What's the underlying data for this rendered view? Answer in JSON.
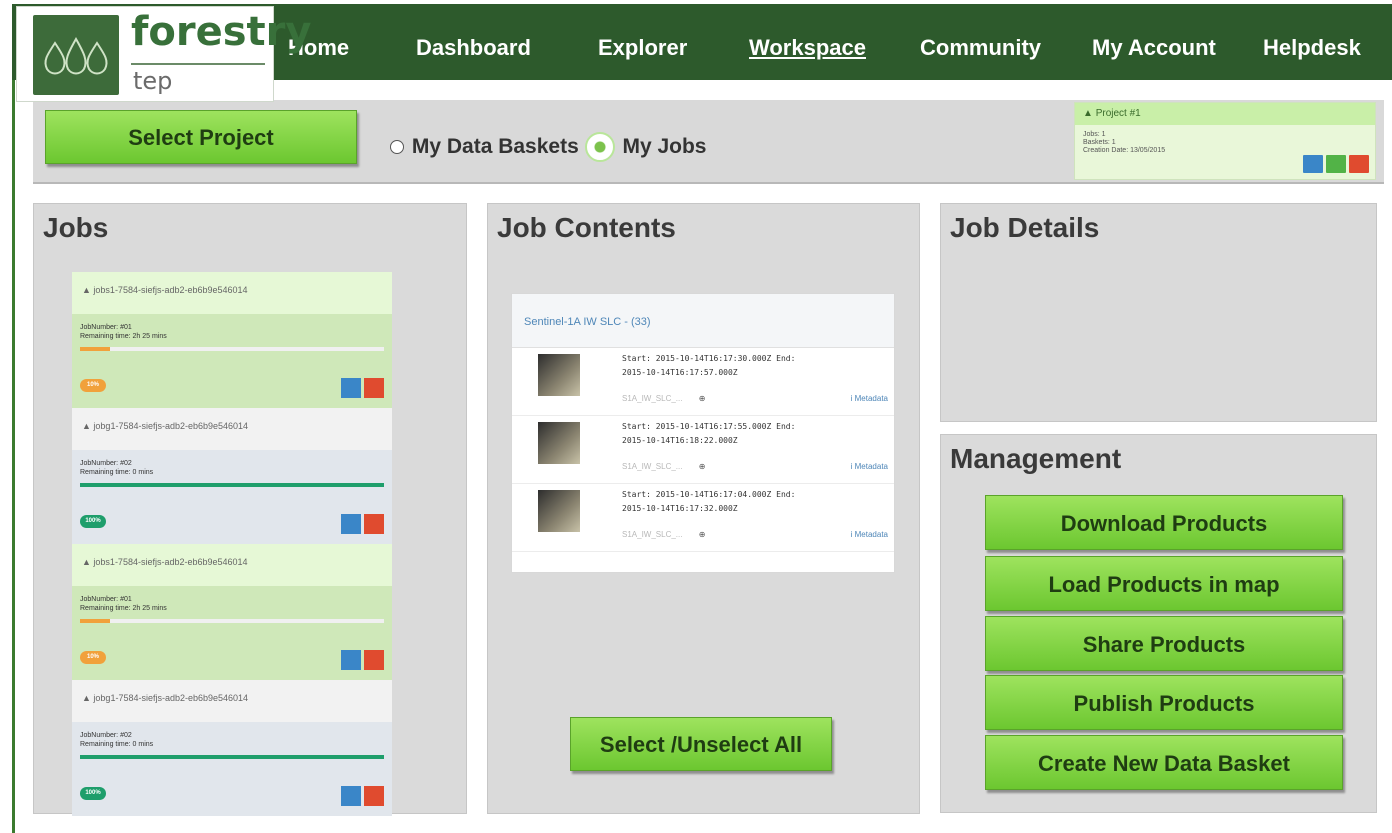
{
  "brand": {
    "name": "forestry",
    "sub": "tep",
    "logo_icon": "forest-drops-logo"
  },
  "nav": {
    "items": [
      {
        "label": "Home",
        "active": false
      },
      {
        "label": "Dashboard",
        "active": false
      },
      {
        "label": "Explorer",
        "active": false
      },
      {
        "label": "Workspace",
        "active": true
      },
      {
        "label": "Community",
        "active": false
      },
      {
        "label": "My Account",
        "active": false
      },
      {
        "label": "Helpdesk",
        "active": false
      }
    ]
  },
  "project_bar": {
    "select_label": "Select Project",
    "radio_baskets": "My Data Baskets",
    "radio_jobs": "My Jobs",
    "selected": "My Jobs",
    "card": {
      "title": "Project #1",
      "line1": "Jobs: 1",
      "line2": "Baskets: 1",
      "line3": "Creation Date: 13/05/2015"
    }
  },
  "jobs": {
    "title": "Jobs",
    "items": [
      {
        "id": "jobs1-7584-siefjs-adb2-eb6b9e546014",
        "number": "JobNumber: #01",
        "remaining": "Remaining time: 2h 25 mins",
        "progress": 0.1,
        "badge": "10%",
        "state": "ok"
      },
      {
        "id": "jobg1-7584-siefjs-adb2-eb6b9e546014",
        "number": "JobNumber: #02",
        "remaining": "Remaining time: 0 mins",
        "progress": 1.0,
        "badge": "100%",
        "state": "run"
      },
      {
        "id": "jobs1-7584-siefjs-adb2-eb6b9e546014",
        "number": "JobNumber: #01",
        "remaining": "Remaining time: 2h 25 mins",
        "progress": 0.1,
        "badge": "10%",
        "state": "ok"
      },
      {
        "id": "jobg1-7584-siefjs-adb2-eb6b9e546014",
        "number": "JobNumber: #02",
        "remaining": "Remaining time: 0 mins",
        "progress": 1.0,
        "badge": "100%",
        "state": "run"
      }
    ]
  },
  "contents": {
    "title": "Job Contents",
    "group": "Sentinel-1A IW SLC - (33)",
    "products": [
      {
        "line1": "Start: 2015-10-14T16:17:30.000Z End:",
        "line2": "2015-10-14T16:17:57.000Z",
        "name": "S1A_IW_SLC_...",
        "metadata": "Metadata"
      },
      {
        "line1": "Start: 2015-10-14T16:17:55.000Z End:",
        "line2": "2015-10-14T16:18:22.000Z",
        "name": "S1A_IW_SLC_...",
        "metadata": "Metadata"
      },
      {
        "line1": "Start: 2015-10-14T16:17:04.000Z End:",
        "line2": "2015-10-14T16:17:32.000Z",
        "name": "S1A_IW_SLC_...",
        "metadata": "Metadata"
      }
    ],
    "select_all": "Select /Unselect All"
  },
  "details": {
    "title": "Job Details"
  },
  "management": {
    "title": "Management",
    "buttons": [
      "Download Products",
      "Load Products in map",
      "Share Products",
      "Publish Products",
      "Create New Data Basket"
    ]
  },
  "colors": {
    "nav_bg": "#2d5a2c",
    "button_green": "#7ed33f",
    "panel_bg": "#dadada"
  }
}
